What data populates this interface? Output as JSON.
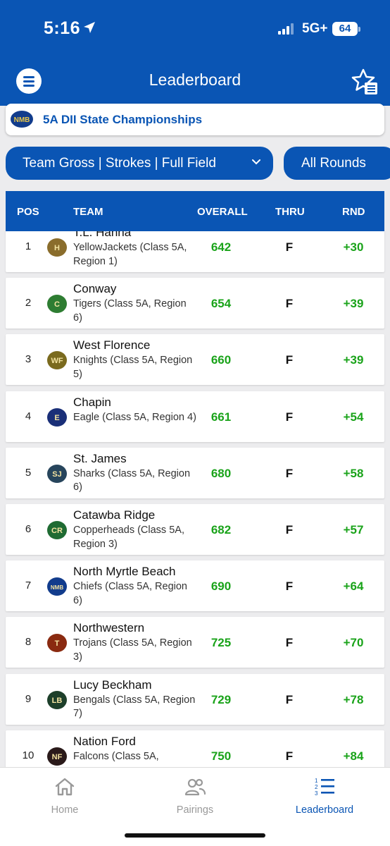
{
  "status_bar": {
    "time": "5:16",
    "network": "5G+",
    "battery": "64"
  },
  "header": {
    "title": "Leaderboard"
  },
  "event": {
    "title": "5A DII State Championships"
  },
  "filters": {
    "view": "Team Gross | Strokes | Full Field",
    "rounds": "All Rounds"
  },
  "table": {
    "columns": {
      "pos": "POS",
      "team": "TEAM",
      "overall": "OVERALL",
      "thru": "THRU",
      "rnd": "RND"
    },
    "rows": [
      {
        "pos": "1",
        "name": "T.L. Hanna",
        "detail": "YellowJackets (Class 5A, Region 1)",
        "overall": "642",
        "thru": "F",
        "rnd": "+30",
        "logo": "hanna-logo-icon",
        "logo_text": "H",
        "logo_color": "#8a6d2c"
      },
      {
        "pos": "2",
        "name": "Conway",
        "detail": "Tigers (Class 5A, Region 6)",
        "overall": "654",
        "thru": "F",
        "rnd": "+39",
        "logo": "conway-logo-icon",
        "logo_text": "C",
        "logo_color": "#2e7d32"
      },
      {
        "pos": "3",
        "name": "West Florence",
        "detail": "Knights (Class 5A, Region 5)",
        "overall": "660",
        "thru": "F",
        "rnd": "+39",
        "logo": "west-florence-logo-icon",
        "logo_text": "WF",
        "logo_color": "#7a6a1e"
      },
      {
        "pos": "4",
        "name": "Chapin",
        "detail": "Eagle (Class 5A, Region 4)",
        "overall": "661",
        "thru": "F",
        "rnd": "+54",
        "logo": "chapin-logo-icon",
        "logo_text": "E",
        "logo_color": "#1a2f78"
      },
      {
        "pos": "5",
        "name": "St. James",
        "detail": "Sharks (Class 5A, Region 6)",
        "overall": "680",
        "thru": "F",
        "rnd": "+58",
        "logo": "st-james-logo-icon",
        "logo_text": "SJ",
        "logo_color": "#27455c"
      },
      {
        "pos": "6",
        "name": "Catawba Ridge",
        "detail": "Copperheads (Class 5A, Region 3)",
        "overall": "682",
        "thru": "F",
        "rnd": "+57",
        "logo": "catawba-ridge-logo-icon",
        "logo_text": "CR",
        "logo_color": "#1f6b33"
      },
      {
        "pos": "7",
        "name": "North Myrtle Beach",
        "detail": "Chiefs (Class 5A, Region 6)",
        "overall": "690",
        "thru": "F",
        "rnd": "+64",
        "logo": "north-myrtle-beach-logo-icon",
        "logo_text": "NMB",
        "logo_color": "#123c8c"
      },
      {
        "pos": "8",
        "name": "Northwestern",
        "detail": "Trojans (Class 5A, Region 3)",
        "overall": "725",
        "thru": "F",
        "rnd": "+70",
        "logo": "northwestern-logo-icon",
        "logo_text": "T",
        "logo_color": "#8a2a10"
      },
      {
        "pos": "9",
        "name": "Lucy Beckham",
        "detail": "Bengals (Class 5A, Region 7)",
        "overall": "729",
        "thru": "F",
        "rnd": "+78",
        "logo": "lucy-beckham-logo-icon",
        "logo_text": "LB",
        "logo_color": "#1d3f2a"
      },
      {
        "pos": "10",
        "name": "Nation Ford",
        "detail": "Falcons (Class 5A,",
        "overall": "750",
        "thru": "F",
        "rnd": "+84",
        "logo": "nation-ford-logo-icon",
        "logo_text": "NF",
        "logo_color": "#2a1a1a"
      }
    ]
  },
  "tabbar": {
    "tabs": [
      {
        "label": "Home",
        "icon": "home-icon",
        "active": false
      },
      {
        "label": "Pairings",
        "icon": "pairings-icon",
        "active": false
      },
      {
        "label": "Leaderboard",
        "icon": "leaderboard-icon",
        "active": true
      }
    ]
  },
  "colors": {
    "brand": "#0a55b4",
    "score_green": "#1aa31a",
    "background": "#ececee"
  }
}
